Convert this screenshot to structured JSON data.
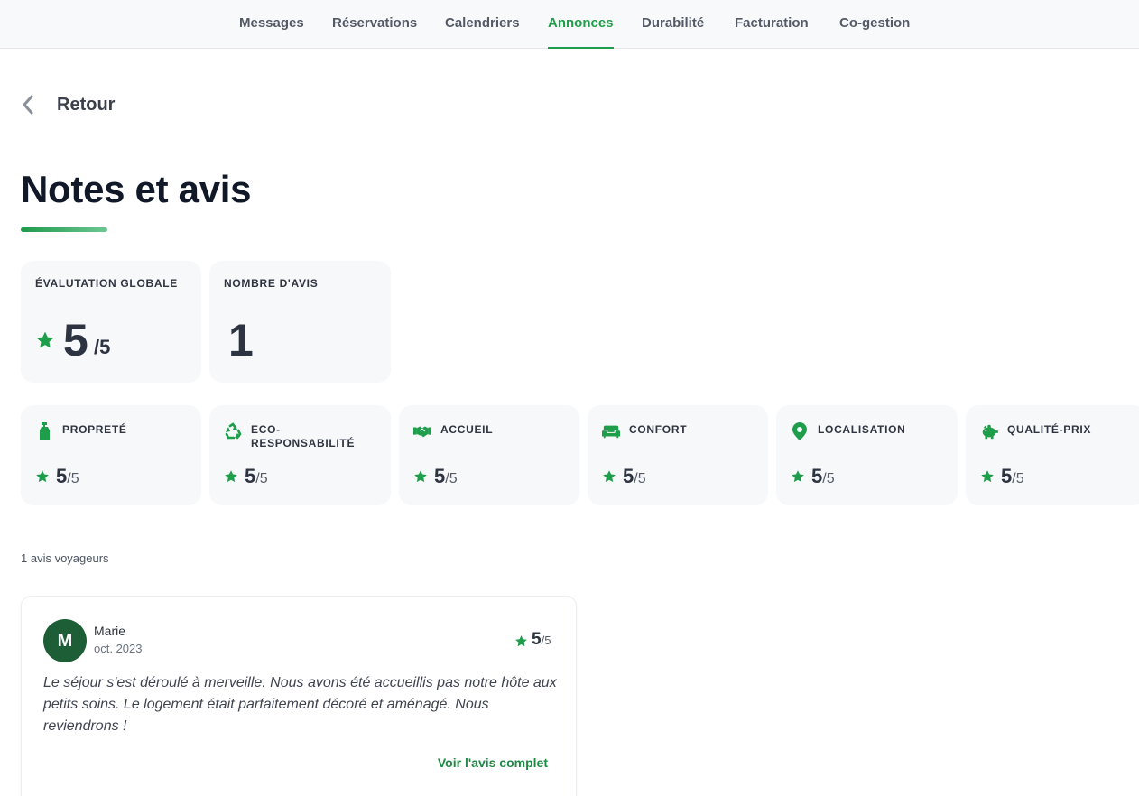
{
  "nav": {
    "items": [
      {
        "label": "Messages"
      },
      {
        "label": "Réservations"
      },
      {
        "label": "Calendriers"
      },
      {
        "label": "Annonces",
        "active": true
      },
      {
        "label": "Durabilité"
      },
      {
        "label": "Facturation"
      },
      {
        "label": "Co-gestion"
      }
    ]
  },
  "back": {
    "label": "Retour",
    "icon": "chevron-left-icon"
  },
  "page": {
    "title": "Notes et avis"
  },
  "summary": {
    "overall": {
      "label": "ÉVALUTATION GLOBALE",
      "value": "5",
      "denominator": "/5",
      "icon": "star-icon"
    },
    "count": {
      "label": "NOMBRE D'AVIS",
      "value": "1"
    }
  },
  "categories": [
    {
      "label": "PROPRETÉ",
      "value": "5",
      "denominator": "/5",
      "icon": "spray-bottle-icon"
    },
    {
      "label": "ECO-RESPONSABILITÉ",
      "label_lines": [
        "ECO-",
        "RESPONSABILITÉ"
      ],
      "value": "5",
      "denominator": "/5",
      "icon": "recycle-icon"
    },
    {
      "label": "ACCUEIL",
      "value": "5",
      "denominator": "/5",
      "icon": "handshake-icon"
    },
    {
      "label": "CONFORT",
      "value": "5",
      "denominator": "/5",
      "icon": "sofa-icon"
    },
    {
      "label": "LOCALISATION",
      "value": "5",
      "denominator": "/5",
      "icon": "map-pin-icon"
    },
    {
      "label": "QUALITÉ-PRIX",
      "value": "5",
      "denominator": "/5",
      "icon": "piggy-bank-icon"
    }
  ],
  "reviews_count_label": "1 avis voyageurs",
  "reviews": [
    {
      "avatar_initial": "M",
      "name": "Marie",
      "date": "oct. 2023",
      "score": "5",
      "denominator": "/5",
      "text": "Le séjour s'est déroulé à merveille. Nous avons été accueillis pas notre hôte aux petits soins. Le logement était parfaitement décoré et aménagé. Nous reviendrons !",
      "link_label": "Voir l'avis complet"
    }
  ],
  "colors": {
    "accent": "#1e9e4a",
    "avatar": "#1d5e36",
    "card_bg": "#f7f8fa",
    "text_dark": "#111827"
  }
}
